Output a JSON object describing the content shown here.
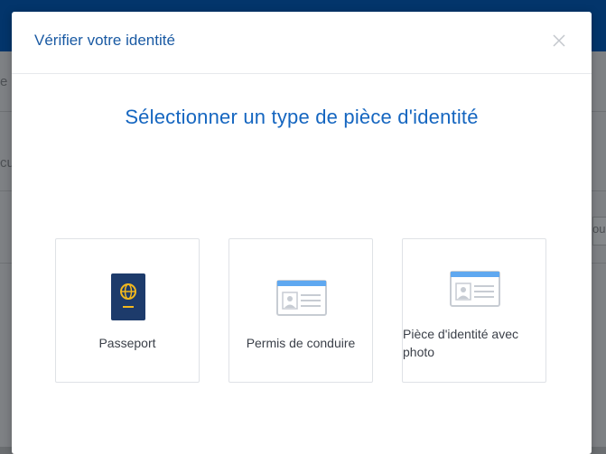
{
  "background": {
    "fragment_1": "e",
    "fragment_2": "cu",
    "fragment_3": "ou"
  },
  "modal": {
    "title": "Vérifier votre identité",
    "close_glyph": "×",
    "heading": "Sélectionner un type de pièce d'identité",
    "options": [
      {
        "label": "Passeport",
        "icon": "passport-icon"
      },
      {
        "label": "Permis de conduire",
        "icon": "id-card-icon"
      },
      {
        "label": "Pièce d'identité avec photo",
        "icon": "id-card-icon"
      }
    ]
  },
  "colors": {
    "header_bar": "#03356b",
    "title": "#1a5aa3",
    "heading": "#1566c0",
    "passport": "#1d3b6b",
    "passport_emblem": "#f2b81e",
    "card_accent": "#5fa8f0",
    "card_lines": "#c7ccd3"
  }
}
